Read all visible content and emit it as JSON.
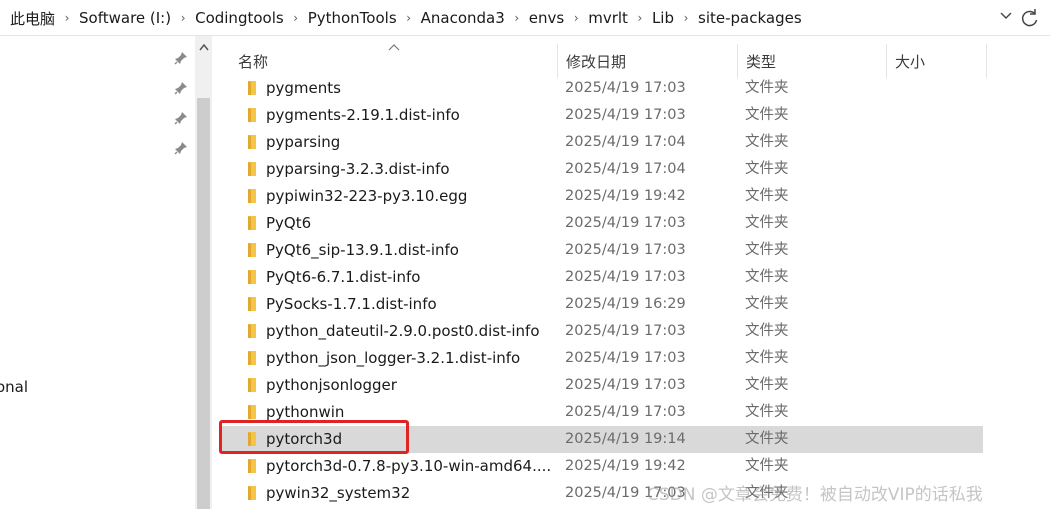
{
  "breadcrumb": [
    "此电脑",
    "Software (I:)",
    "Codingtools",
    "PythonTools",
    "Anaconda3",
    "envs",
    "mvrlt",
    "Lib",
    "site-packages"
  ],
  "nav": {
    "partial_label": "onal"
  },
  "columns": {
    "name": "名称",
    "date": "修改日期",
    "type": "类型",
    "size": "大小"
  },
  "rows": [
    {
      "name": "pygments",
      "date": "2025/4/19 17:03",
      "type": "文件夹"
    },
    {
      "name": "pygments-2.19.1.dist-info",
      "date": "2025/4/19 17:03",
      "type": "文件夹"
    },
    {
      "name": "pyparsing",
      "date": "2025/4/19 17:04",
      "type": "文件夹"
    },
    {
      "name": "pyparsing-3.2.3.dist-info",
      "date": "2025/4/19 17:04",
      "type": "文件夹"
    },
    {
      "name": "pypiwin32-223-py3.10.egg",
      "date": "2025/4/19 19:42",
      "type": "文件夹"
    },
    {
      "name": "PyQt6",
      "date": "2025/4/19 17:03",
      "type": "文件夹"
    },
    {
      "name": "PyQt6_sip-13.9.1.dist-info",
      "date": "2025/4/19 17:03",
      "type": "文件夹"
    },
    {
      "name": "PyQt6-6.7.1.dist-info",
      "date": "2025/4/19 17:03",
      "type": "文件夹"
    },
    {
      "name": "PySocks-1.7.1.dist-info",
      "date": "2025/4/19 16:29",
      "type": "文件夹"
    },
    {
      "name": "python_dateutil-2.9.0.post0.dist-info",
      "date": "2025/4/19 17:03",
      "type": "文件夹"
    },
    {
      "name": "python_json_logger-3.2.1.dist-info",
      "date": "2025/4/19 17:03",
      "type": "文件夹"
    },
    {
      "name": "pythonjsonlogger",
      "date": "2025/4/19 17:03",
      "type": "文件夹"
    },
    {
      "name": "pythonwin",
      "date": "2025/4/19 17:03",
      "type": "文件夹"
    },
    {
      "name": "pytorch3d",
      "date": "2025/4/19 19:14",
      "type": "文件夹",
      "selected": true
    },
    {
      "name": "pytorch3d-0.7.8-py3.10-win-amd64....",
      "date": "2025/4/19 19:42",
      "type": "文件夹"
    },
    {
      "name": "pywin32_system32",
      "date": "2025/4/19 17:03",
      "type": "文件夹"
    }
  ],
  "watermark": "CSDN @文章会免费！被自动改VIP的话私我",
  "colors": {
    "folder": "#f5c54a",
    "selected_row": "#d9d9d9",
    "highlight_box": "#e02424"
  }
}
